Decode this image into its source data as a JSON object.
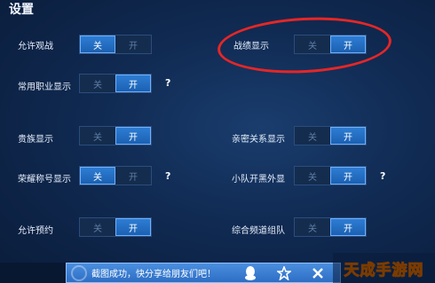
{
  "title": "设置",
  "on": "开",
  "off": "关",
  "help": "?",
  "settings": [
    {
      "label": "允许观战",
      "state": "off"
    },
    {
      "label": "战绩显示",
      "state": "on"
    },
    {
      "label": "常用职业显示",
      "state": "on"
    },
    {
      "label": "贵族显示",
      "state": "on"
    },
    {
      "label": "亲密关系显示",
      "state": "on"
    },
    {
      "label": "荣耀称号显示",
      "state": "off"
    },
    {
      "label": "小队开黑外显",
      "state": "on"
    },
    {
      "label": "允许预约",
      "state": "on"
    },
    {
      "label": "综合频道组队",
      "state": "on"
    }
  ],
  "toast": {
    "text": "截图成功，快分享给朋友们吧！"
  },
  "watermark": "天成手游网",
  "colors": {
    "accent": "#2f7fd6",
    "highlight": "#e62626",
    "watermark": "#f2a933"
  }
}
